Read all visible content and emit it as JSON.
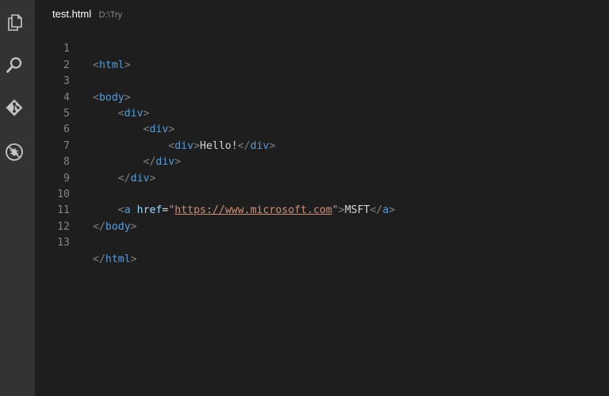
{
  "tab": {
    "filename": "test.html",
    "path": "D:\\Try"
  },
  "activity_bar": {
    "icons": [
      "files-icon",
      "search-icon",
      "git-icon",
      "debug-icon"
    ]
  },
  "editor": {
    "line_numbers": [
      "1",
      "2",
      "3",
      "4",
      "5",
      "6",
      "7",
      "8",
      "9",
      "10",
      "11",
      "12",
      "13"
    ],
    "lines": {
      "l1": {
        "open": "<",
        "tag": "html",
        "close": ">"
      },
      "l3": {
        "open": "<",
        "tag": "body",
        "close": ">"
      },
      "l4": {
        "indent": "    ",
        "open": "<",
        "tag": "div",
        "close": ">"
      },
      "l5": {
        "indent": "        ",
        "open": "<",
        "tag": "div",
        "close": ">"
      },
      "l6": {
        "indent": "            ",
        "open": "<",
        "tag": "div",
        "close": ">",
        "text": "Hello!",
        "end_open": "</",
        "end_tag": "div",
        "end_close": ">"
      },
      "l7": {
        "indent": "        ",
        "open": "</",
        "tag": "div",
        "close": ">"
      },
      "l8": {
        "indent": "    ",
        "open": "</",
        "tag": "div",
        "close": ">"
      },
      "l10": {
        "indent": "    ",
        "open": "<",
        "tag": "a",
        "space": " ",
        "attr": "href",
        "eq": "=",
        "quote1": "\"",
        "url": "https://www.microsoft.com",
        "quote2": "\"",
        "close": ">",
        "text": "MSFT",
        "end_open": "</",
        "end_tag": "a",
        "end_close": ">"
      },
      "l11": {
        "open": "</",
        "tag": "body",
        "close": ">"
      },
      "l13": {
        "open": "</",
        "tag": "html",
        "close": ">"
      }
    }
  },
  "colors": {
    "background": "#1e1e1e",
    "activity_bar": "#333333",
    "tag": "#569cd6",
    "attribute": "#9cdcfe",
    "string": "#ce9178",
    "punctuation": "#808080",
    "line_number": "#858585"
  }
}
